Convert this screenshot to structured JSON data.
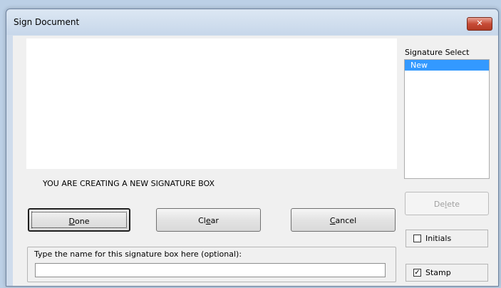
{
  "window": {
    "title": "Sign Document",
    "close_symbol": "✕"
  },
  "canvas": {
    "message": "YOU ARE CREATING A NEW SIGNATURE BOX"
  },
  "signature_select": {
    "label": "Signature Select",
    "items": [
      {
        "label": "New",
        "selected": true
      }
    ]
  },
  "buttons": {
    "done": {
      "pre": "",
      "mn": "D",
      "post": "one"
    },
    "clear": {
      "pre": "Cl",
      "mn": "e",
      "post": "ar"
    },
    "cancel": {
      "pre": "",
      "mn": "C",
      "post": "ancel"
    },
    "delete": {
      "pre": "De",
      "mn": "l",
      "post": "ete",
      "disabled": true
    }
  },
  "name_group": {
    "label": "Type the name for this signature box here (optional):",
    "value": ""
  },
  "options": {
    "initials": {
      "label": "Initials",
      "checked": false
    },
    "stamp": {
      "label": "Stamp",
      "checked": true,
      "mark": "✓"
    }
  },
  "colors": {
    "selection": "#3399ff",
    "close_button": "#c74b36"
  }
}
